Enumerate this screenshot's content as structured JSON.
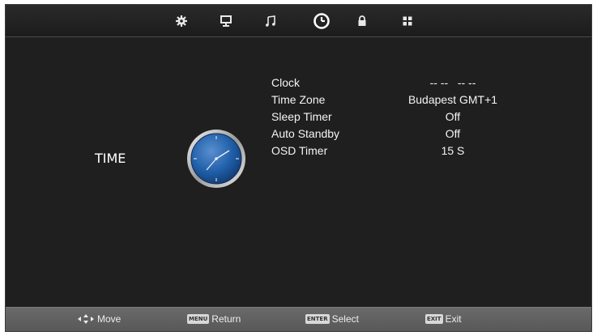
{
  "menu_tabs": [
    {
      "name": "picture-settings",
      "icon": "gear-icon"
    },
    {
      "name": "display",
      "icon": "monitor-icon"
    },
    {
      "name": "sound",
      "icon": "music-note-icon"
    },
    {
      "name": "time",
      "icon": "clock-icon",
      "active": true
    },
    {
      "name": "lock",
      "icon": "lock-icon"
    },
    {
      "name": "options",
      "icon": "grid-icon"
    }
  ],
  "section": {
    "title": "TIME",
    "emblem_icon": "analog-clock-icon"
  },
  "settings": [
    {
      "label": "Clock",
      "value": "-- --   -- --"
    },
    {
      "label": "Time Zone",
      "value": "Budapest GMT+1"
    },
    {
      "label": "Sleep Timer",
      "value": "Off"
    },
    {
      "label": "Auto Standby",
      "value": "Off"
    },
    {
      "label": "OSD Timer",
      "value": "15 S"
    }
  ],
  "hints": {
    "move": {
      "label": "Move"
    },
    "return": {
      "key": "MENU",
      "label": "Return"
    },
    "select": {
      "key": "ENTER",
      "label": "Select"
    },
    "exit": {
      "key": "EXIT",
      "label": "Exit"
    }
  },
  "colors": {
    "background": "#1f1f1f",
    "bottom_bar": "#606060",
    "clock_face": "#1f5fa8"
  }
}
